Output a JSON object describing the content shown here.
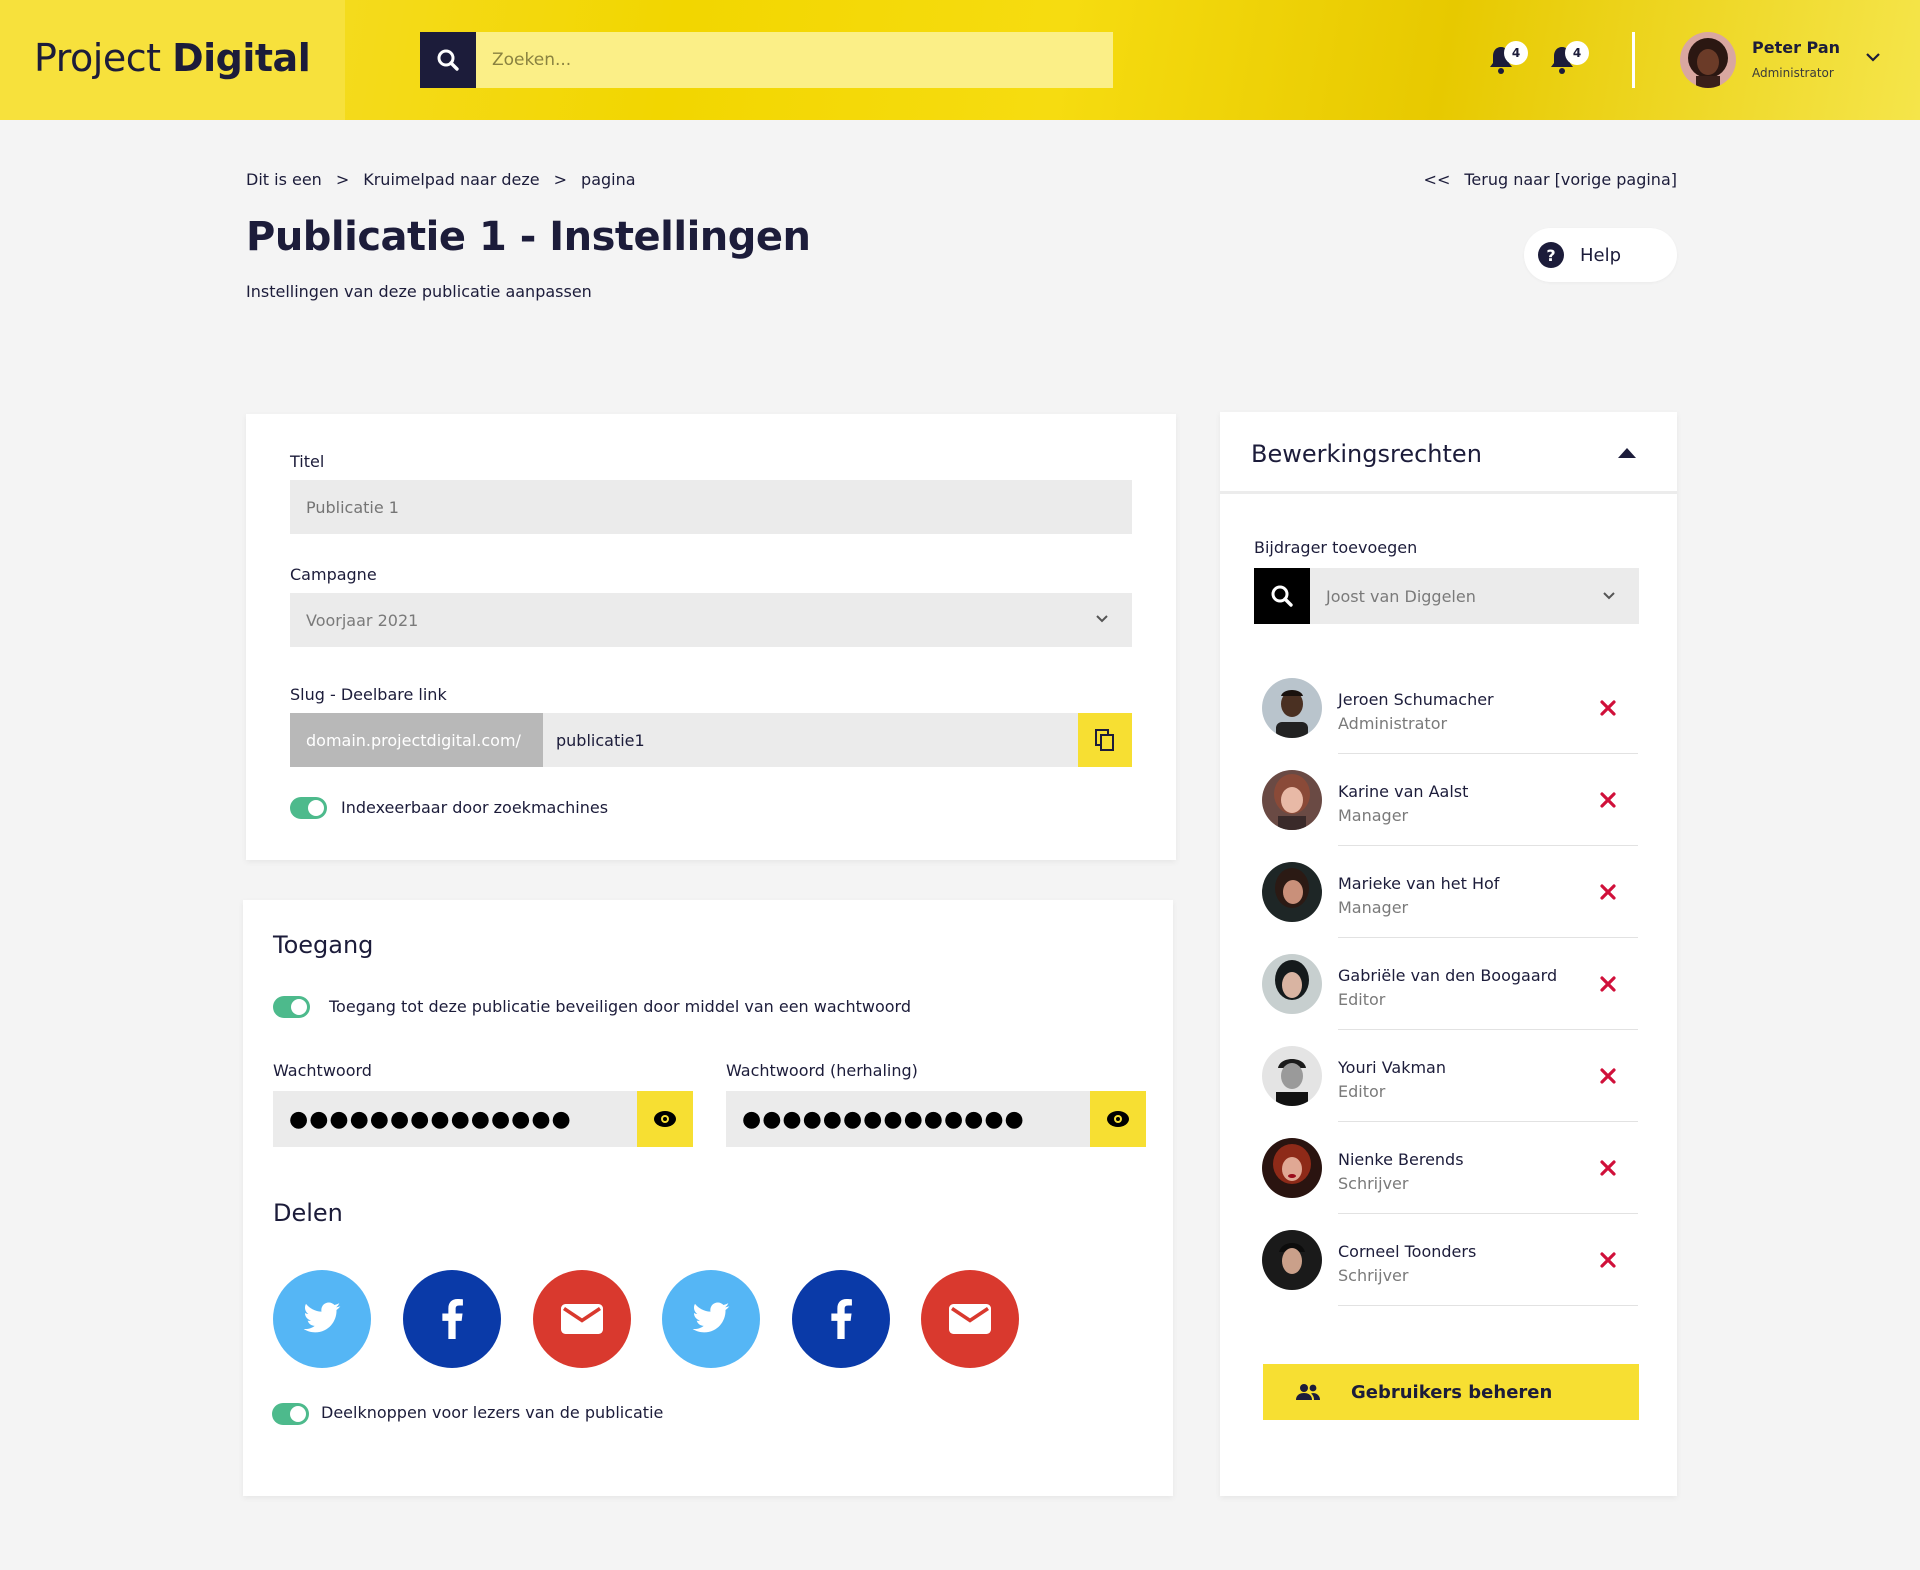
{
  "header": {
    "logo_light": "Project ",
    "logo_bold": "Digital",
    "search_placeholder": "Zoeken...",
    "notifications": [
      {
        "count": "4"
      },
      {
        "count": "4"
      }
    ],
    "user": {
      "name": "Peter Pan",
      "role": "Administrator"
    }
  },
  "breadcrumb": [
    "Dit is een",
    "Kruimelpad naar deze",
    "pagina"
  ],
  "breadcrumb_separator": ">",
  "back_link": {
    "prefix": "<<",
    "label": "Terug naar [vorige pagina]"
  },
  "page": {
    "title": "Publicatie 1 - Instellingen",
    "subtitle": "Instellingen van deze publicatie aanpassen",
    "help_label": "Help"
  },
  "settings": {
    "title_label": "Titel",
    "title_placeholder": "Publicatie 1",
    "campaign_label": "Campagne",
    "campaign_value": "Voorjaar 2021",
    "slug_label": "Slug - Deelbare link",
    "slug_prefix": "domain.projectdigital.com/",
    "slug_value": "publicatie1",
    "index_toggle_label": "Indexeerbaar door zoekmachines",
    "index_toggle_on": true
  },
  "access": {
    "title": "Toegang",
    "password_toggle_label": "Toegang tot deze publicatie beveiligen door middel van een wachtwoord",
    "password_label": "Wachtwoord",
    "password_repeat_label": "Wachtwoord (herhaling)",
    "password_mask": "●●●●●●●●●●●●●●",
    "password_repeat_mask": "●●●●●●●●●●●●●●"
  },
  "share": {
    "title": "Delen",
    "buttons": [
      "twitter-icon",
      "facebook-icon",
      "email-icon",
      "twitter-icon",
      "facebook-icon",
      "email-icon"
    ],
    "toggle_label": "Deelknoppen voor lezers van de publicatie"
  },
  "permissions": {
    "title": "Bewerkingsrechten",
    "add_label": "Bijdrager toevoegen",
    "add_value": "Joost van Diggelen",
    "users": [
      {
        "name": "Jeroen Schumacher",
        "role": "Administrator"
      },
      {
        "name": "Karine van Aalst",
        "role": "Manager"
      },
      {
        "name": "Marieke van het Hof",
        "role": "Manager"
      },
      {
        "name": "Gabriële van den Boogaard",
        "role": "Editor"
      },
      {
        "name": "Youri Vakman",
        "role": "Editor"
      },
      {
        "name": "Nienke Berends",
        "role": "Schrijver"
      },
      {
        "name": "Corneel Toonders",
        "role": "Schrijver"
      }
    ],
    "manage_label": "Gebruikers beheren"
  },
  "colors": {
    "brand_yellow": "#f7df32",
    "navy": "#1c1c3a",
    "toggle_green": "#4dba8c",
    "remove_red": "#d0103a",
    "twitter": "#55b6f5",
    "facebook": "#0a3aa8",
    "email": "#d9392e"
  }
}
